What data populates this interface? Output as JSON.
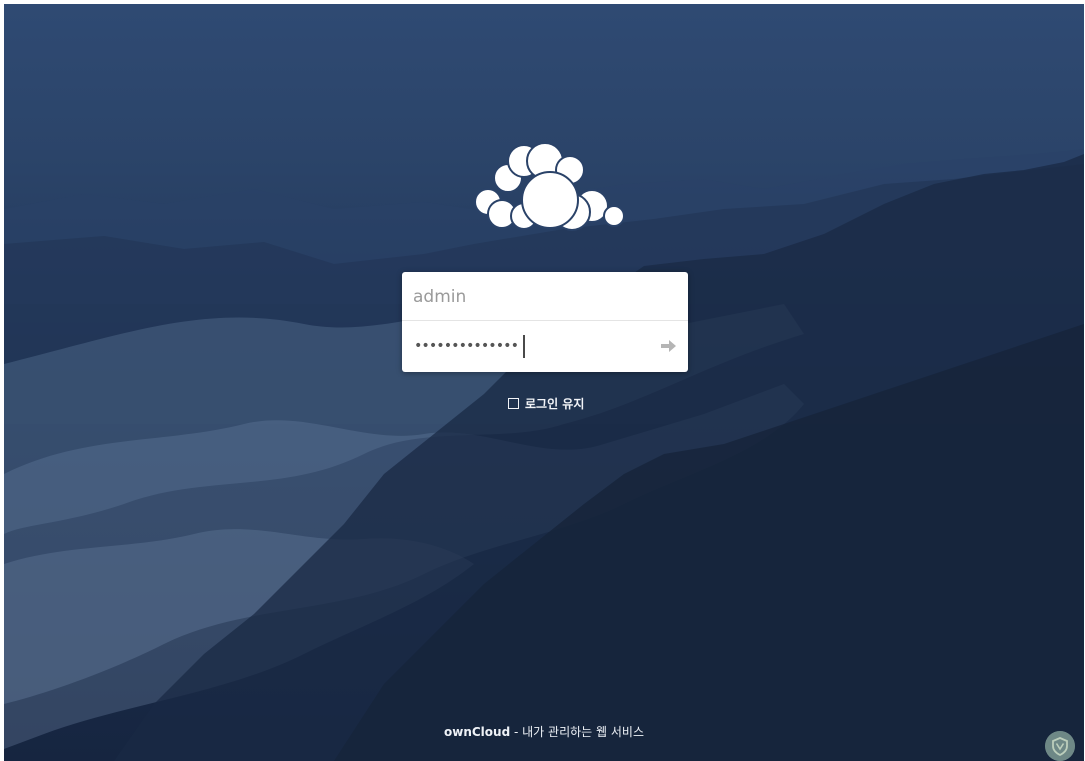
{
  "login": {
    "username_value": "admin",
    "password_masked": "••••••••••••••",
    "remember_label": "로그인 유지"
  },
  "footer": {
    "brand": "ownCloud",
    "separator": " - ",
    "tagline": "내가 관리하는 웹 서비스"
  },
  "icons": {
    "logo": "owncloud-cloud-icon",
    "submit": "arrow-right-icon",
    "shield": "shield-icon"
  },
  "colors": {
    "background_top": "#2f4a73",
    "background_bottom": "#162540",
    "panel": "#ffffff",
    "text_light": "#f2f4f8"
  }
}
